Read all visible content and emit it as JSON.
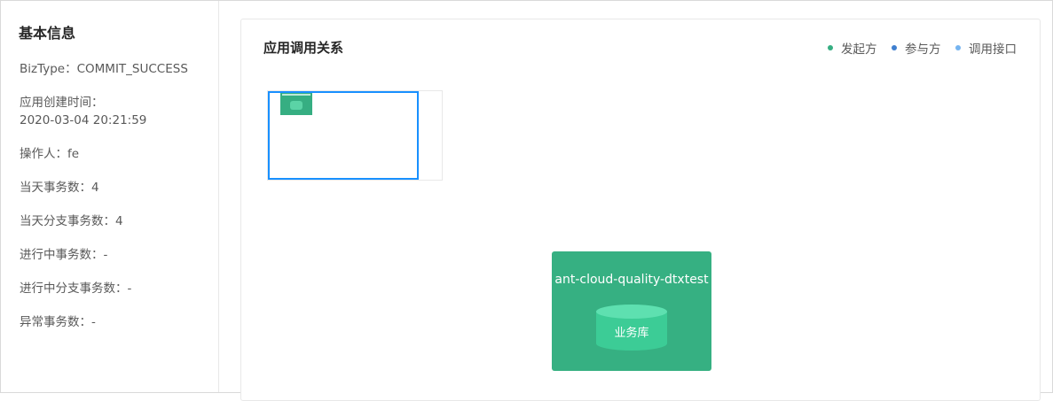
{
  "basic_info": {
    "title": "基本信息",
    "biz_type": "BizType：COMMIT_SUCCESS",
    "create_time_label": "应用创建时间：",
    "create_time_value": "2020-03-04 20:21:59",
    "operator": "操作人：fe",
    "today_tx": "当天事务数：4",
    "today_branch_tx": "当天分支事务数：4",
    "in_progress_tx": "进行中事务数：-",
    "in_progress_branch_tx": "进行中分支事务数：-",
    "abnormal_tx": "异常事务数：-"
  },
  "panel": {
    "title": "应用调用关系",
    "legend": [
      {
        "label": "发起方",
        "color": "#36ae82"
      },
      {
        "label": "参与方",
        "color": "#3f7fcf"
      },
      {
        "label": "调用接口",
        "color": "#75b4f0"
      }
    ]
  },
  "node": {
    "app_name": "ant-cloud-quality-dtxtest",
    "db_label": "业务库",
    "color": "#36b082"
  },
  "minimap": {
    "viewport_color": "#1890ff"
  }
}
